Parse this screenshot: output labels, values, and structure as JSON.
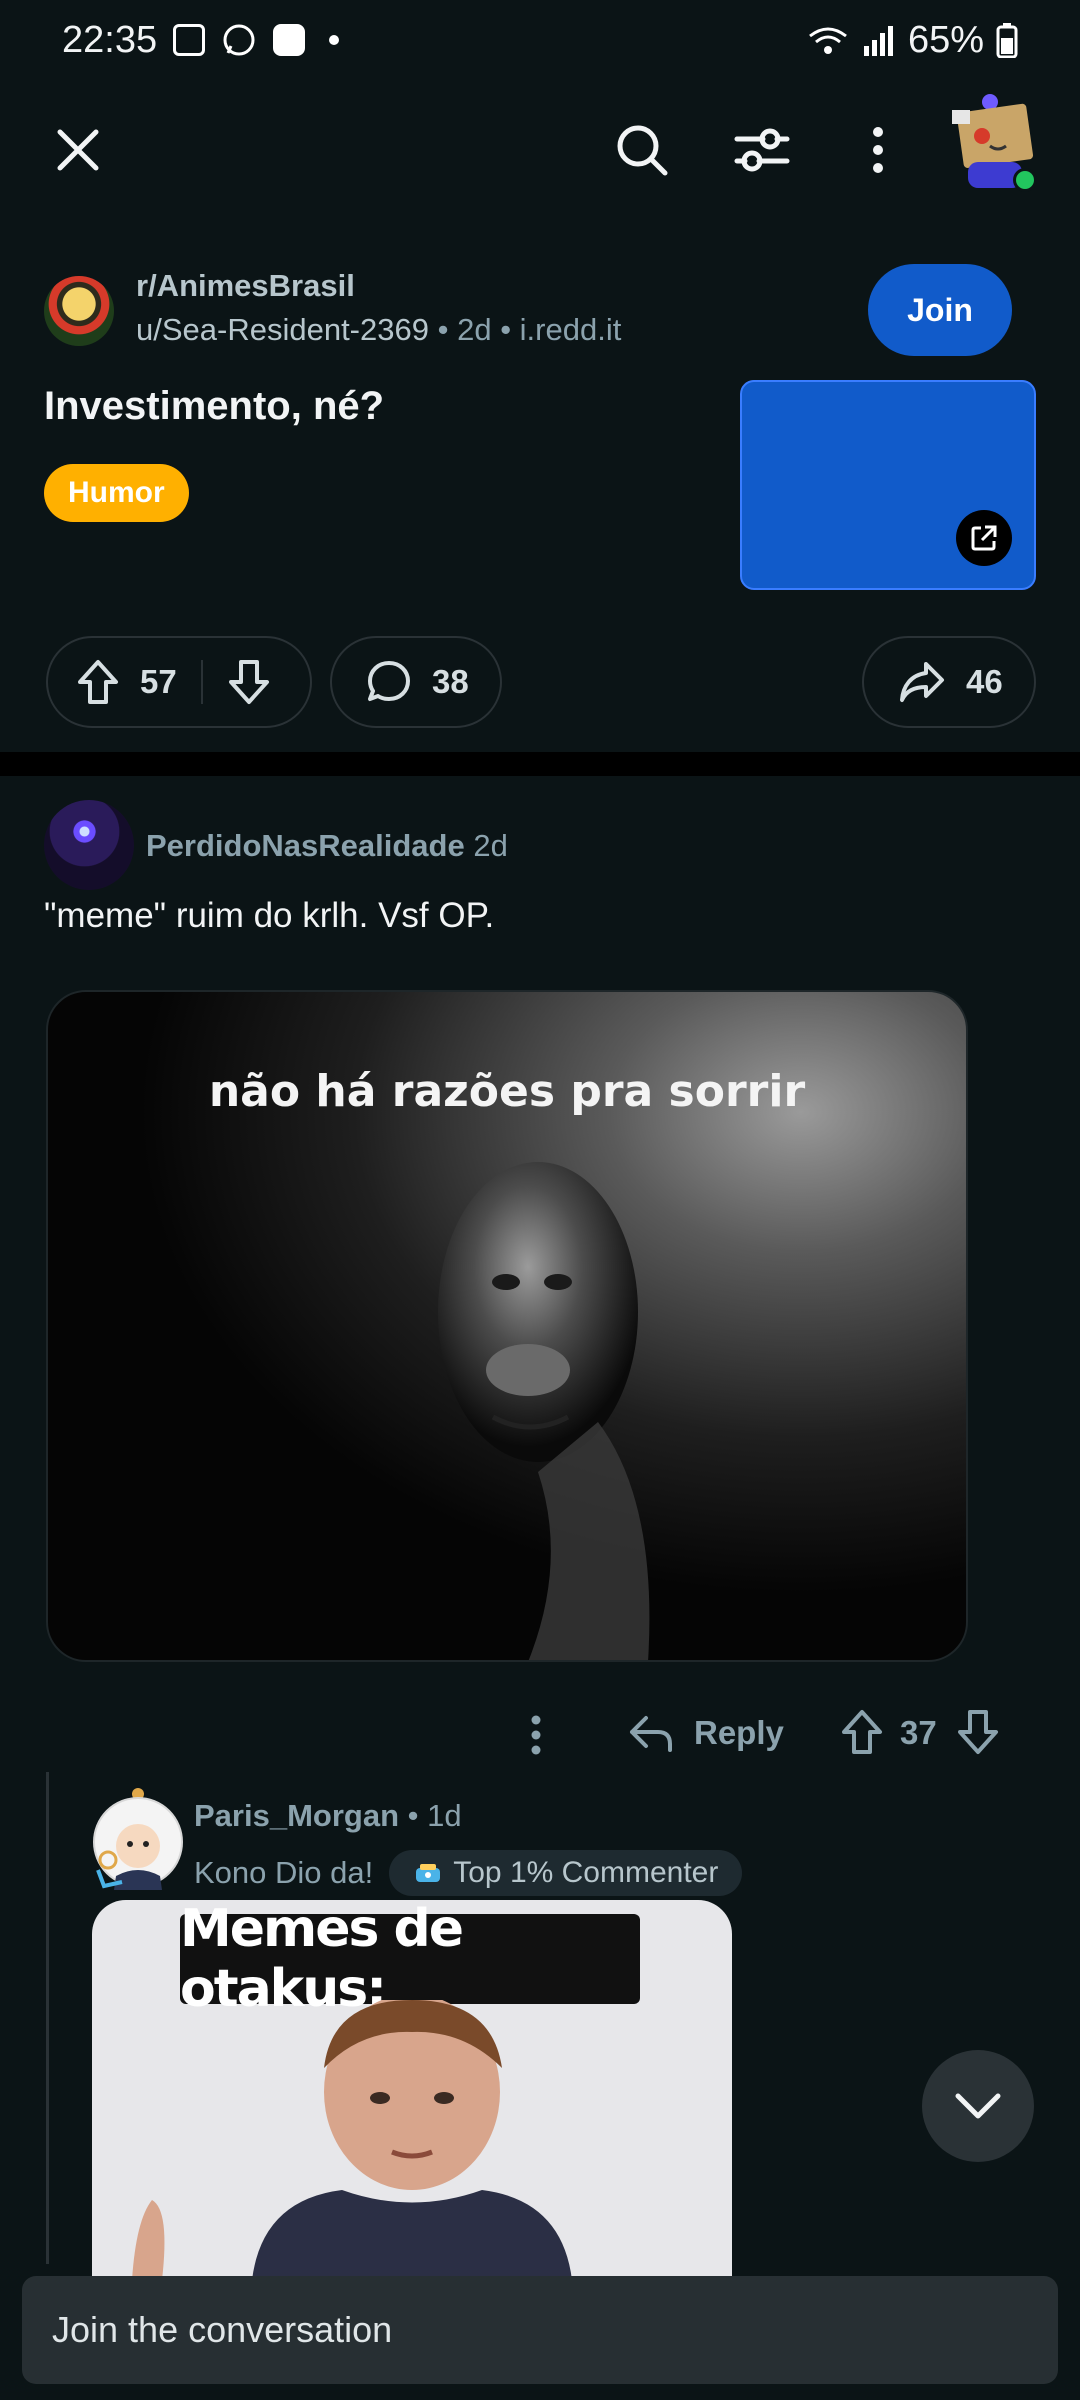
{
  "status": {
    "time": "22:35",
    "battery": "65%"
  },
  "post": {
    "subreddit": "r/AnimesBrasil",
    "author": "u/Sea-Resident-2369",
    "age": "2d",
    "domain": "i.redd.it",
    "join_label": "Join",
    "title": "Investimento, né?",
    "flair": "Humor",
    "upvotes": "57",
    "comments": "38",
    "shares": "46",
    "thumb_color": "#115bca",
    "flair_color": "#ffb000"
  },
  "comments": [
    {
      "author": "PerdidoNasRealidade",
      "age": "2d",
      "body": "\"meme\" ruim do krlh. Vsf OP.",
      "image_caption": "não há razões pra sorrir",
      "reply_label": "Reply",
      "votes": "37"
    },
    {
      "author": "Paris_Morgan",
      "age": "1d",
      "flair_text": "Kono Dio da!",
      "badge": "Top 1% Commenter",
      "image_caption": "Memes de otakus:"
    }
  ],
  "footer": {
    "placeholder": "Join the conversation"
  }
}
